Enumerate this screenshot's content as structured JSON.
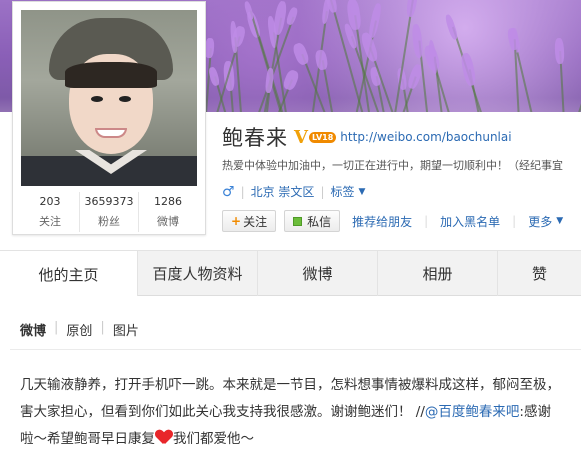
{
  "profile": {
    "name": "鲍春来",
    "verified_badge": "V",
    "level_badge": "LV18",
    "url": "http://weibo.com/baochunlai",
    "bio": "热爱中体验中加油中，一切正在进行中，期望一切顺利中！（经纪事宜",
    "gender_icon": "♂",
    "location": "北京 崇文区",
    "tag_label": "标签",
    "stats": [
      {
        "value": "203",
        "label": "关注"
      },
      {
        "value": "3659373",
        "label": "粉丝"
      },
      {
        "value": "1286",
        "label": "微博"
      }
    ]
  },
  "actions": {
    "follow": "关注",
    "follow_plus": "+",
    "message": "私信",
    "recommend": "推荐给朋友",
    "blacklist": "加入黑名单",
    "more": "更多"
  },
  "tabs": [
    {
      "label": "他的主页",
      "active": true
    },
    {
      "label": "百度人物资料",
      "active": false
    },
    {
      "label": "微博",
      "active": false
    },
    {
      "label": "相册",
      "active": false
    },
    {
      "label": "赞",
      "active": false
    }
  ],
  "feed": {
    "subnav": [
      "微博",
      "原创",
      "图片"
    ],
    "post": {
      "line1": "几天输液静养，打开手机吓一跳。本来就是一节目，怎料想事情被爆料成这样，郁闷至极，",
      "line2_a": "害大家担心，但看到你们如此关心我支持我很感激。谢谢鲍迷们！ //",
      "mention": "@百度鲍春来吧",
      "line2_b": ":感谢",
      "line3_a": "啦～希望鲍哥早日康复",
      "line3_b": "我们都爱他～"
    }
  },
  "colors": {
    "link": "#2b6ab3",
    "badge": "#f0a10b",
    "heart": "#e8262a",
    "cover": "#8a5fb7"
  },
  "icons": {
    "heart": "heart-icon",
    "gender": "male-icon",
    "message": "message-icon",
    "dropdown": "triangle-down-icon"
  }
}
